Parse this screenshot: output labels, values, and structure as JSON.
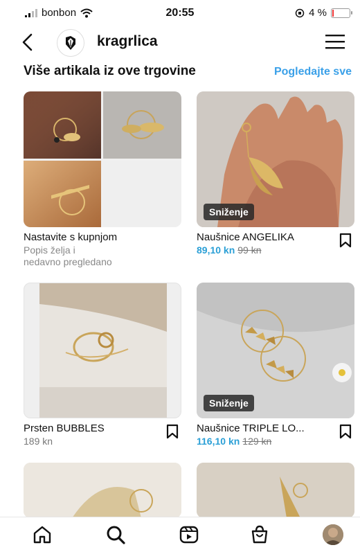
{
  "status": {
    "carrier": "bonbon",
    "time": "20:55",
    "battery": "4 %"
  },
  "header": {
    "shop_name": "kragrlica"
  },
  "section": {
    "title": "Više artikala iz ove trgovine",
    "see_all": "Pogledajte sve"
  },
  "cards": [
    {
      "title": "Nastavite s kupnjom",
      "subtitle_line1": "Popis želja i",
      "subtitle_line2": "nedavno pregledano"
    },
    {
      "title": "Naušnice ANGELIKA",
      "price": "89,10 kn",
      "old_price": "99 kn",
      "badge": "Sniženje"
    },
    {
      "title": "Prsten BUBBLES",
      "price": "189 kn"
    },
    {
      "title": "Naušnice TRIPLE LO...",
      "price": "116,10 kn",
      "old_price": "129 kn",
      "badge": "Sniženje"
    }
  ],
  "tabs": [
    "home-icon",
    "search-icon",
    "reels-icon",
    "shop-icon",
    "profile-avatar"
  ]
}
